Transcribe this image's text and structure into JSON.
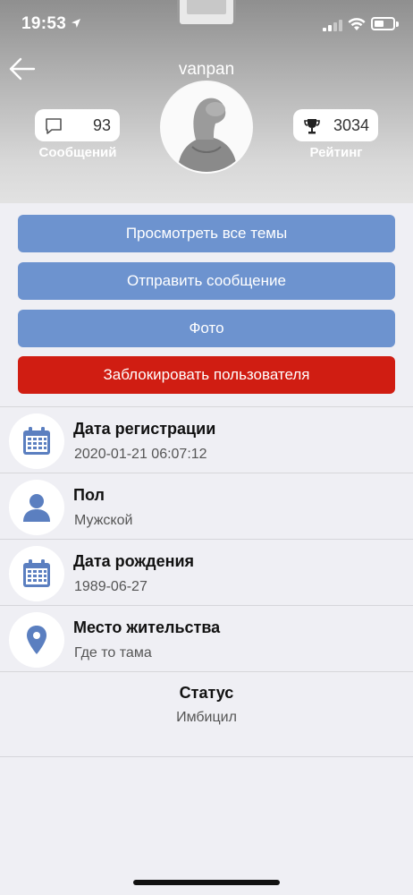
{
  "status_bar": {
    "time": "19:53"
  },
  "header": {
    "username": "vanpan",
    "messages": {
      "value": "93",
      "label": "Сообщений",
      "icon": "chat-bubble-icon"
    },
    "rating": {
      "value": "3034",
      "label": "Рейтинг",
      "icon": "trophy-icon"
    }
  },
  "actions": {
    "view_topics": "Просмотреть все темы",
    "send_message": "Отправить сообщение",
    "photo": "Фото",
    "block_user": "Заблокировать пользователя"
  },
  "info": [
    {
      "title": "Дата регистрации",
      "value": "2020-01-21 06:07:12",
      "icon": "calendar-icon"
    },
    {
      "title": "Пол",
      "value": "Мужской",
      "icon": "user-icon"
    },
    {
      "title": "Дата рождения",
      "value": "1989-06-27",
      "icon": "calendar-icon"
    },
    {
      "title": "Место жительства",
      "value": "Где то тама",
      "icon": "location-pin-icon"
    }
  ],
  "status": {
    "title": "Статус",
    "value": "Имбицил"
  },
  "colors": {
    "accent_blue": "#6d93cf",
    "danger_red": "#d01d12",
    "icon_blue": "#5b7fc0"
  }
}
